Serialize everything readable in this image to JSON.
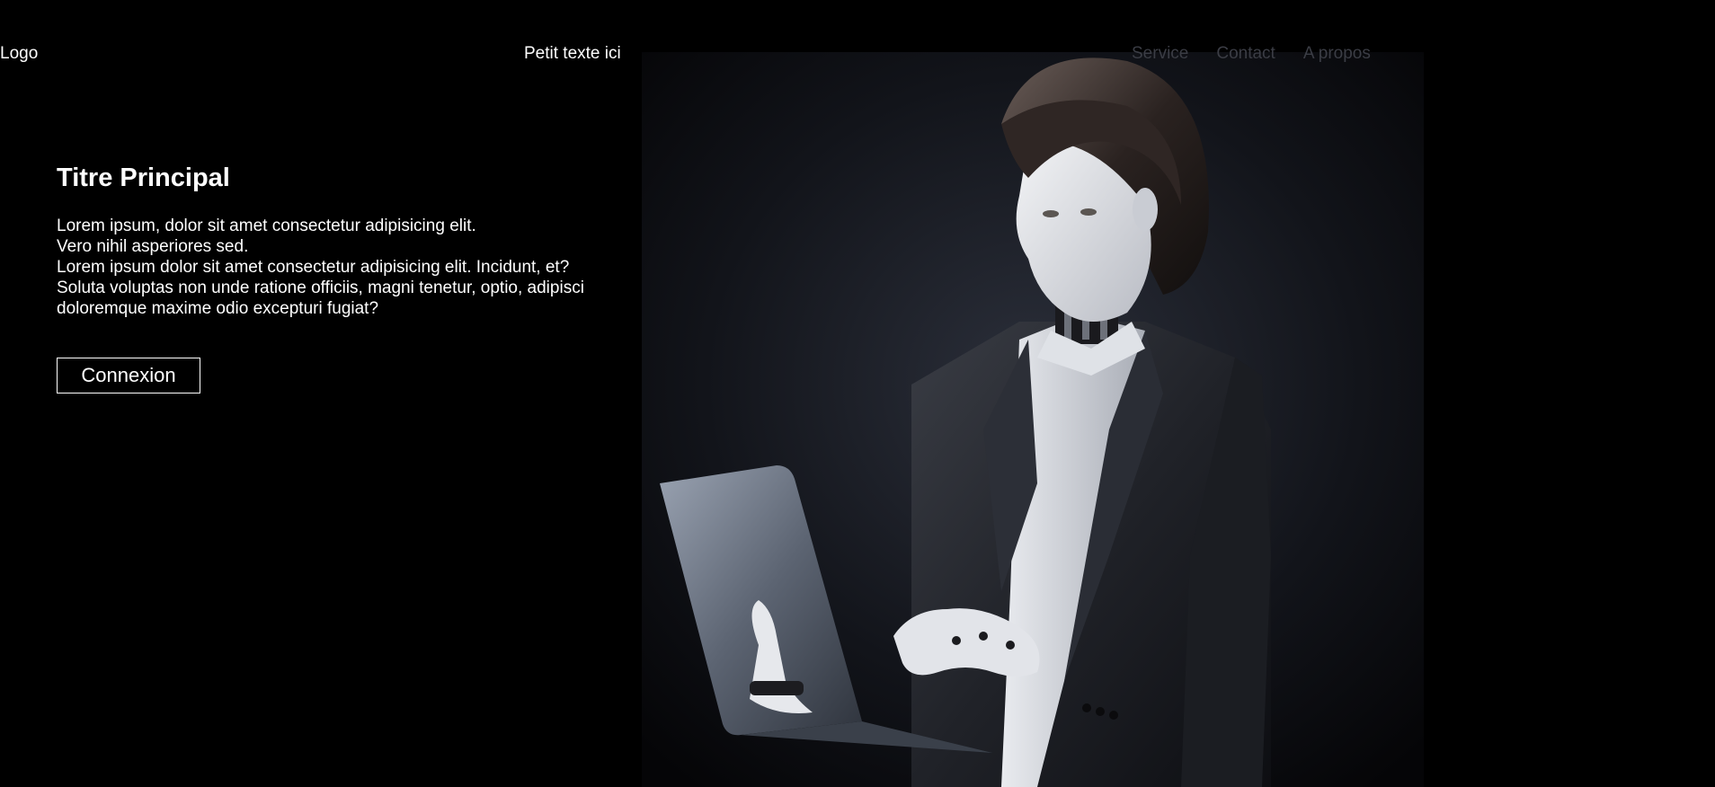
{
  "header": {
    "logo": "Logo",
    "tagline": "Petit texte ici",
    "nav": [
      {
        "label": "Service"
      },
      {
        "label": "Contact"
      },
      {
        "label": "A propos"
      }
    ]
  },
  "hero": {
    "title": "Titre Principal",
    "lines": [
      "Lorem ipsum, dolor sit amet consectetur adipisicing elit.",
      "Vero nihil asperiores sed.",
      "Lorem ipsum dolor sit amet consectetur adipisicing elit. Incidunt, et?",
      "Soluta voluptas non unde ratione officiis, magni tenetur, optio, adipisci",
      "doloremque maxime odio excepturi fugiat?"
    ],
    "button_label": "Connexion"
  },
  "colors": {
    "background": "#000000",
    "text": "#ffffff",
    "nav_text": "#3b3d45"
  }
}
